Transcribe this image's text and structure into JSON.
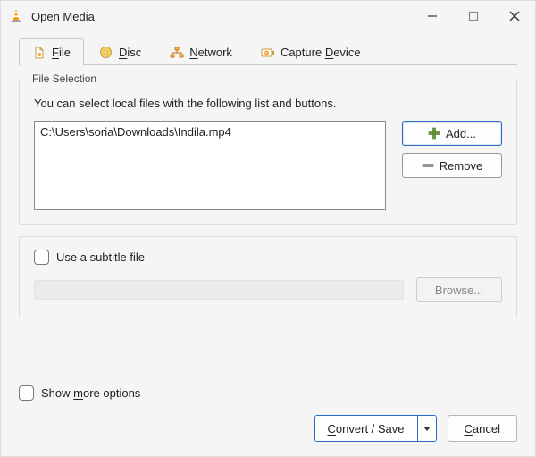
{
  "window": {
    "title": "Open Media"
  },
  "tabs": {
    "file": {
      "label": "File",
      "underlineIndex": 0
    },
    "disc": {
      "label": "Disc",
      "underlineIndex": 0
    },
    "network": {
      "label": "Network",
      "underlineIndex": 0
    },
    "capture": {
      "label": "Capture Device",
      "underlineIndex": 8
    }
  },
  "file_selection": {
    "legend": "File Selection",
    "hint": "You can select local files with the following list and buttons.",
    "files": [
      "C:\\Users\\soria\\Downloads\\Indila.mp4"
    ],
    "add_label": "Add...",
    "remove_label": "Remove"
  },
  "subtitle": {
    "checkbox_label": "Use a subtitle file",
    "checked": false,
    "path": "",
    "browse_label": "Browse..."
  },
  "more_options": {
    "label": "Show more options",
    "underlineIndex": 5,
    "checked": false
  },
  "actions": {
    "convert_save": "Convert / Save",
    "convert_underlineIndex": 0,
    "cancel": "Cancel",
    "cancel_underlineIndex": 0
  }
}
